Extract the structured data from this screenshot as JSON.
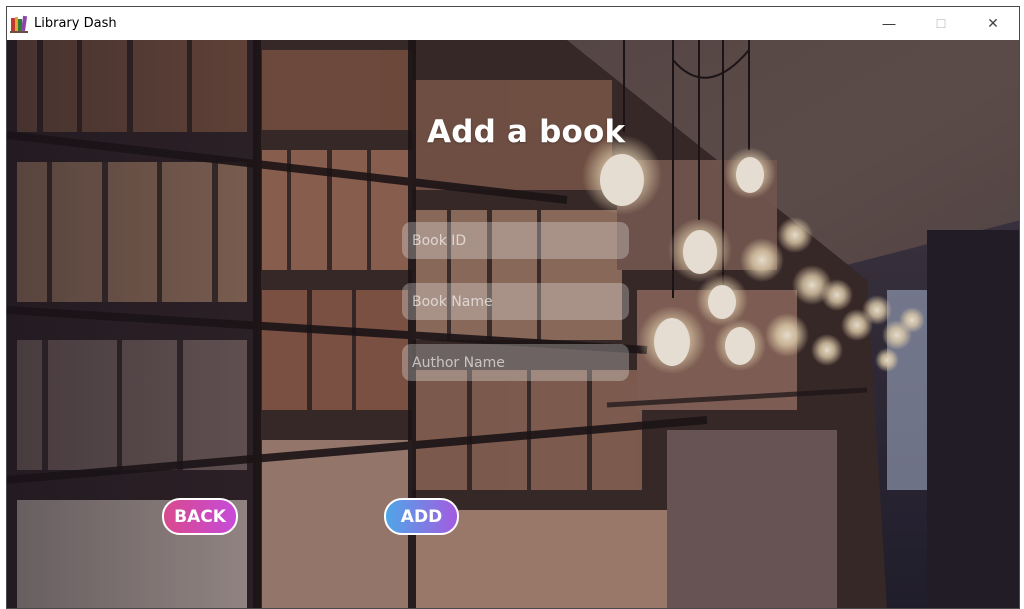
{
  "window": {
    "title": "Library Dash",
    "controls": {
      "minimize": "—",
      "maximize": "☐",
      "close": "✕"
    }
  },
  "page": {
    "heading": "Add a book",
    "fields": [
      {
        "placeholder": "Book ID",
        "value": ""
      },
      {
        "placeholder": "Book Name",
        "value": ""
      },
      {
        "placeholder": "Author Name",
        "value": ""
      }
    ],
    "buttons": {
      "back": "BACK",
      "add": "ADD"
    }
  },
  "icons": {
    "app": "books-icon"
  },
  "colors": {
    "back_gradient": [
      "#d94a8c",
      "#c64bd9"
    ],
    "add_gradient": [
      "#4fa6e8",
      "#a35be0"
    ],
    "field_bg": "rgba(255,255,255,0.28)"
  }
}
